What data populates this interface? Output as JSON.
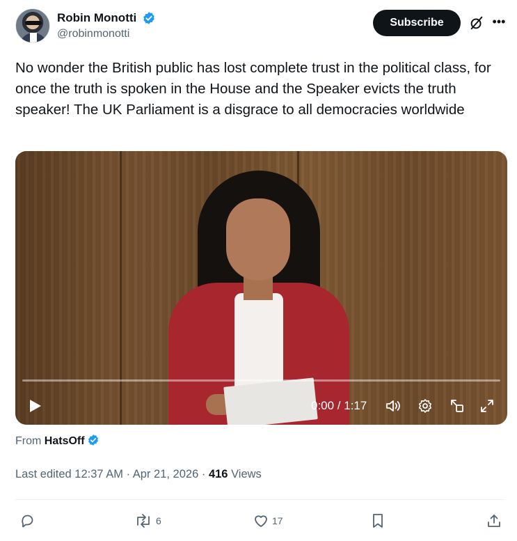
{
  "author": {
    "display_name": "Robin Monotti",
    "handle": "@robinmonotti",
    "verified": true
  },
  "header": {
    "subscribe_label": "Subscribe",
    "grok_icon": "slashed-circle-icon",
    "more_icon": "more-horizontal-icon"
  },
  "tweet": {
    "text": "No wonder the British public has lost complete trust in the political class, for once the truth is spoken in the House and the Speaker evicts the truth speaker! The UK Parliament is a disgrace to all democracies worldwide"
  },
  "video": {
    "time": "0:00 / 1:17",
    "controls": [
      "play-icon",
      "volume-icon",
      "settings-icon",
      "pip-icon",
      "fullscreen-icon"
    ]
  },
  "source": {
    "prefix": "From",
    "name": "HatsOff",
    "verified": true
  },
  "meta": {
    "edited_label": "Last edited 12:37 AM · Apr 21, 2026 ·",
    "views_count": "416",
    "views_label": "Views"
  },
  "actions": {
    "reply_count": "",
    "retweet_count": "6",
    "like_count": "17"
  },
  "colors": {
    "verified_blue": "#1d9bf0",
    "text_primary": "#0f1419",
    "text_secondary": "#536471",
    "button_dark": "#0f1419"
  }
}
